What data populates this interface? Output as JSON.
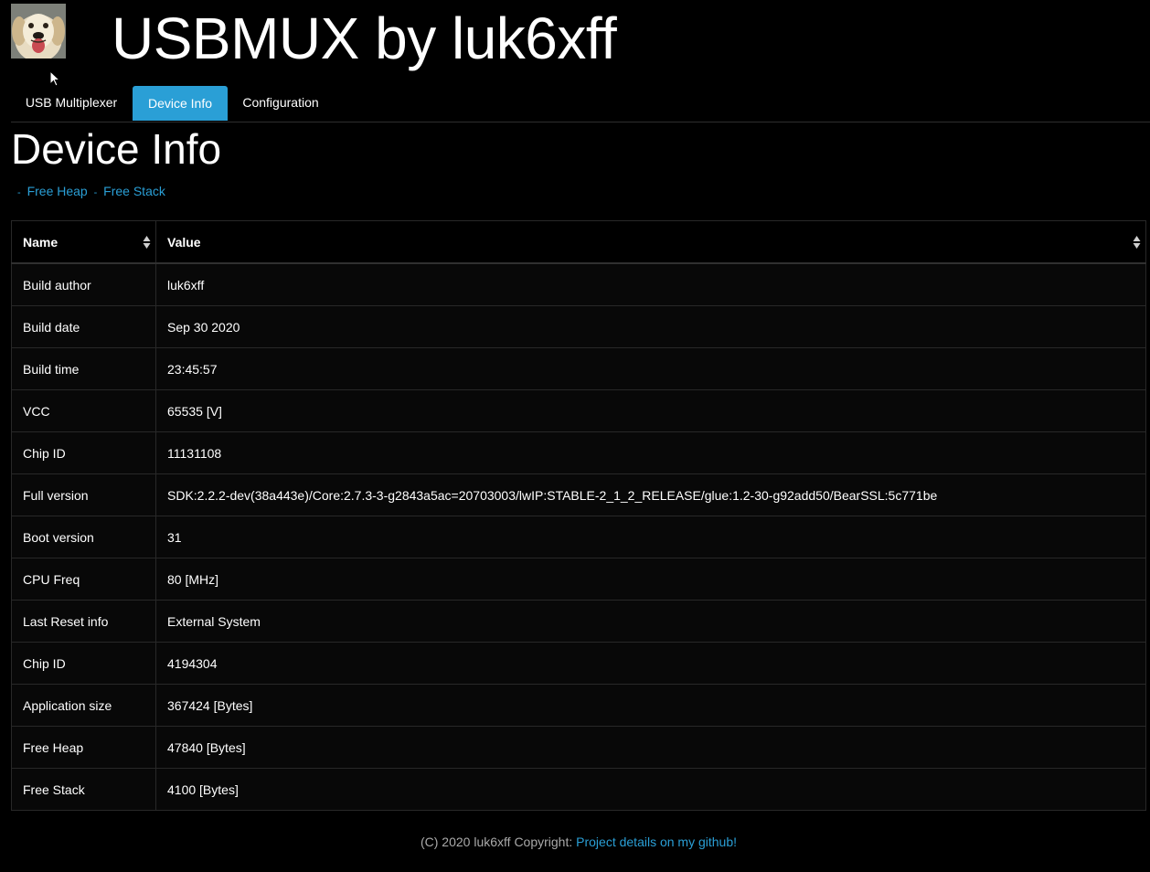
{
  "header": {
    "title": "USBMUX by luk6xff",
    "avatar_icon": "puppy-avatar-image"
  },
  "tabs": [
    {
      "label": "USB Multiplexer",
      "active": false
    },
    {
      "label": "Device Info",
      "active": true
    },
    {
      "label": "Configuration",
      "active": false
    }
  ],
  "page": {
    "heading": "Device Info",
    "links": [
      {
        "label": "Free Heap"
      },
      {
        "label": "Free Stack"
      }
    ],
    "link_separator": "-"
  },
  "table": {
    "columns": [
      "Name",
      "Value"
    ],
    "rows": [
      {
        "name": "Build author",
        "value": "luk6xff"
      },
      {
        "name": "Build date",
        "value": "Sep 30 2020"
      },
      {
        "name": "Build time",
        "value": "23:45:57"
      },
      {
        "name": "VCC",
        "value": "65535 [V]"
      },
      {
        "name": "Chip ID",
        "value": "11131108"
      },
      {
        "name": "Full version",
        "value": "SDK:2.2.2-dev(38a443e)/Core:2.7.3-3-g2843a5ac=20703003/lwIP:STABLE-2_1_2_RELEASE/glue:1.2-30-g92add50/BearSSL:5c771be"
      },
      {
        "name": "Boot version",
        "value": "31"
      },
      {
        "name": "CPU Freq",
        "value": "80 [MHz]"
      },
      {
        "name": "Last Reset info",
        "value": "External System"
      },
      {
        "name": "Chip ID",
        "value": "4194304"
      },
      {
        "name": "Application size",
        "value": "367424 [Bytes]"
      },
      {
        "name": "Free Heap",
        "value": "47840 [Bytes]"
      },
      {
        "name": "Free Stack",
        "value": "4100 [Bytes]"
      }
    ]
  },
  "footer": {
    "copyright": "(C) 2020 luk6xff Copyright: ",
    "link_label": "Project details on my github!"
  },
  "colors": {
    "background": "#000000",
    "accent": "#2a9fd6",
    "text": "#ffffff",
    "muted": "#aaaaaa"
  }
}
